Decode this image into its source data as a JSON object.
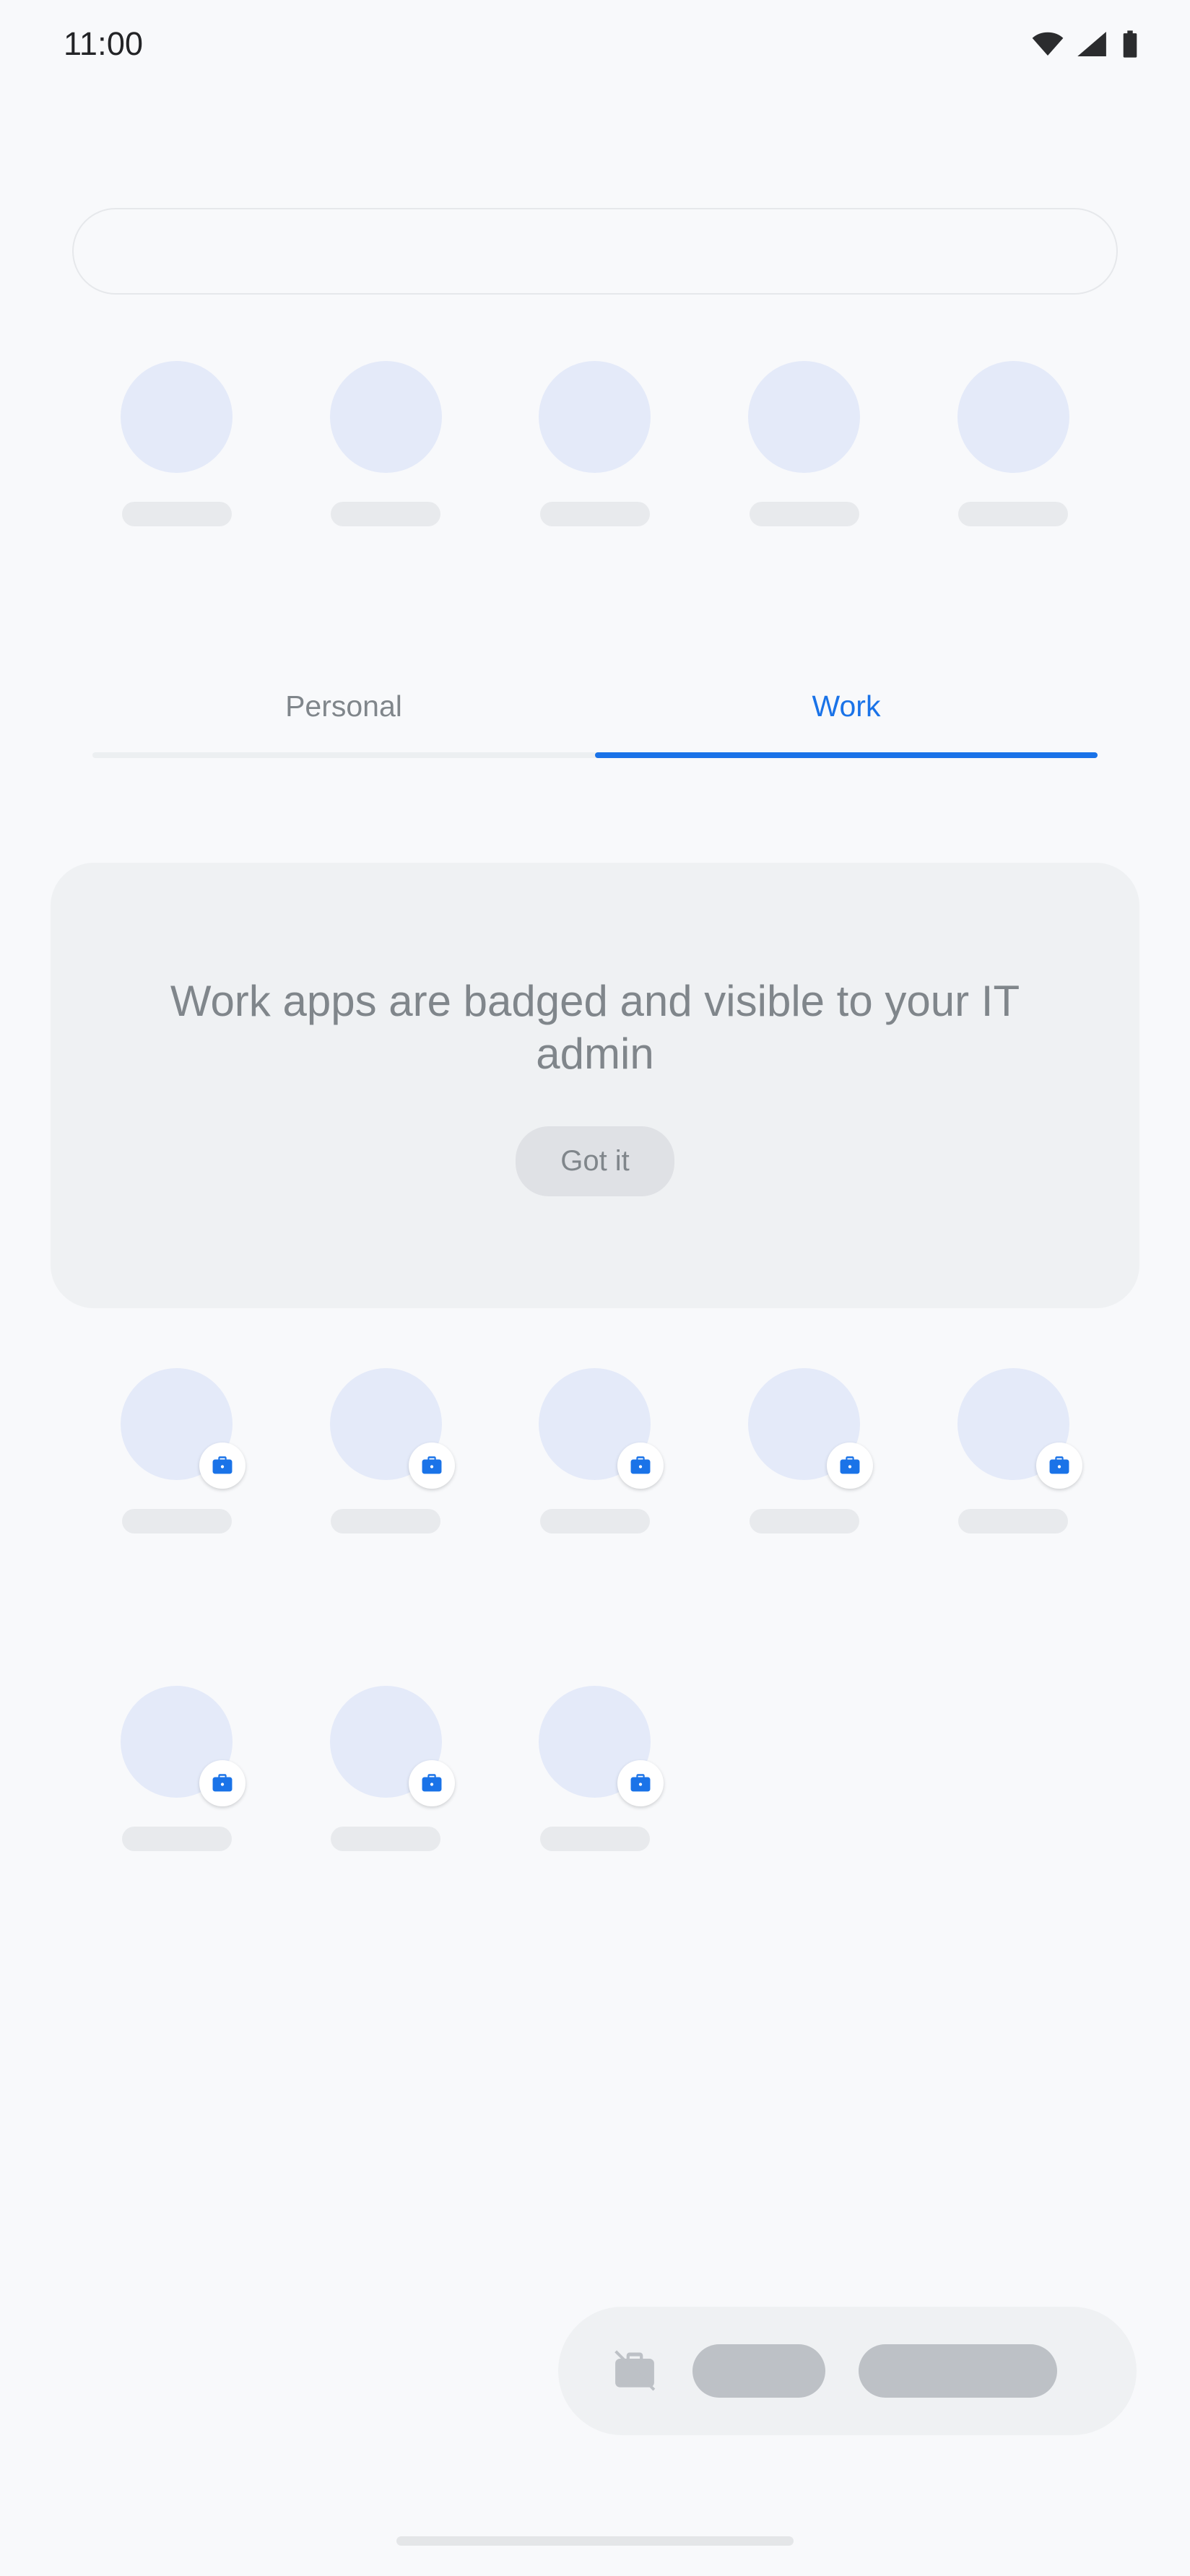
{
  "status_bar": {
    "time": "11:00",
    "icons": [
      "wifi-icon",
      "cell-signal-icon",
      "battery-icon"
    ]
  },
  "search": {
    "value": "",
    "placeholder": ""
  },
  "top_apps": {
    "count": 5,
    "badged": false,
    "items": [
      {
        "label": ""
      },
      {
        "label": ""
      },
      {
        "label": ""
      },
      {
        "label": ""
      },
      {
        "label": ""
      }
    ]
  },
  "tabs": [
    {
      "label": "Personal",
      "active": false
    },
    {
      "label": "Work",
      "active": true
    }
  ],
  "info_card": {
    "title": "Work apps are badged and visible to your IT admin",
    "button_label": "Got it"
  },
  "work_apps": {
    "badge_icon": "work-briefcase-badge-icon",
    "rows": [
      {
        "count": 5,
        "items": [
          {
            "label": ""
          },
          {
            "label": ""
          },
          {
            "label": ""
          },
          {
            "label": ""
          },
          {
            "label": ""
          }
        ]
      },
      {
        "count": 3,
        "items": [
          {
            "label": ""
          },
          {
            "label": ""
          },
          {
            "label": ""
          }
        ]
      }
    ]
  },
  "work_bar": {
    "icon": "work-off-icon",
    "placeholders": [
      "",
      ""
    ]
  },
  "colors": {
    "accent": "#1a73e8",
    "background": "#f8f9fb",
    "card": "#eff1f3",
    "icon_placeholder": "#e4eaf9",
    "label_placeholder": "#e8eaed",
    "muted_text": "#80868b",
    "bar_placeholder": "#bdc1c6"
  }
}
